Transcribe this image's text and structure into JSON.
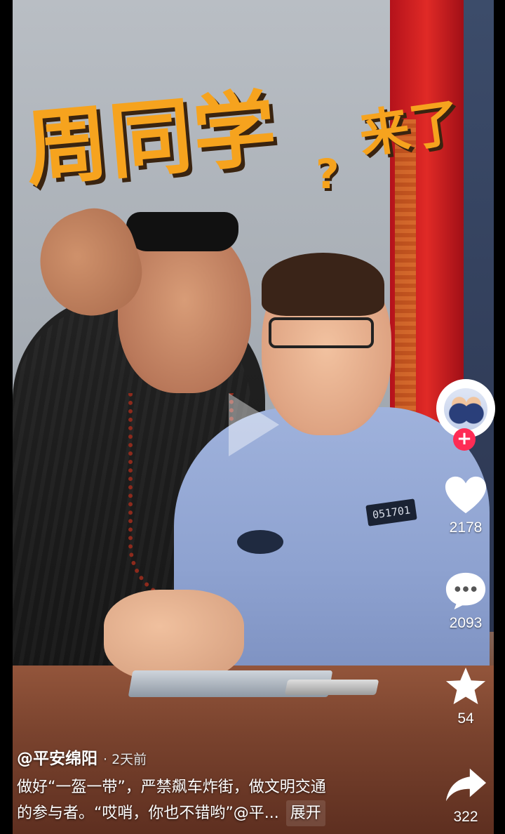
{
  "video": {
    "title_main": "周同学",
    "title_question": "?",
    "title_sub": "来了",
    "badge_number": "051701"
  },
  "author": {
    "handle": "@平安绵阳",
    "time": "· 2天前",
    "follow_symbol": "+"
  },
  "caption": {
    "line1": "做好“一盔一带”，严禁飙车炸街，做文明交通",
    "line2": "的参与者。“哎哨，你也不错哟”@平...",
    "expand_label": "展开"
  },
  "actions": {
    "likes": "2178",
    "comments": "2093",
    "favorites": "54",
    "shares": "322"
  },
  "colors": {
    "title": "#f6a31e",
    "follow": "#fe2c55"
  },
  "icons": [
    "play-icon",
    "heart-icon",
    "comment-icon",
    "star-icon",
    "share-icon",
    "follow-plus-icon"
  ]
}
